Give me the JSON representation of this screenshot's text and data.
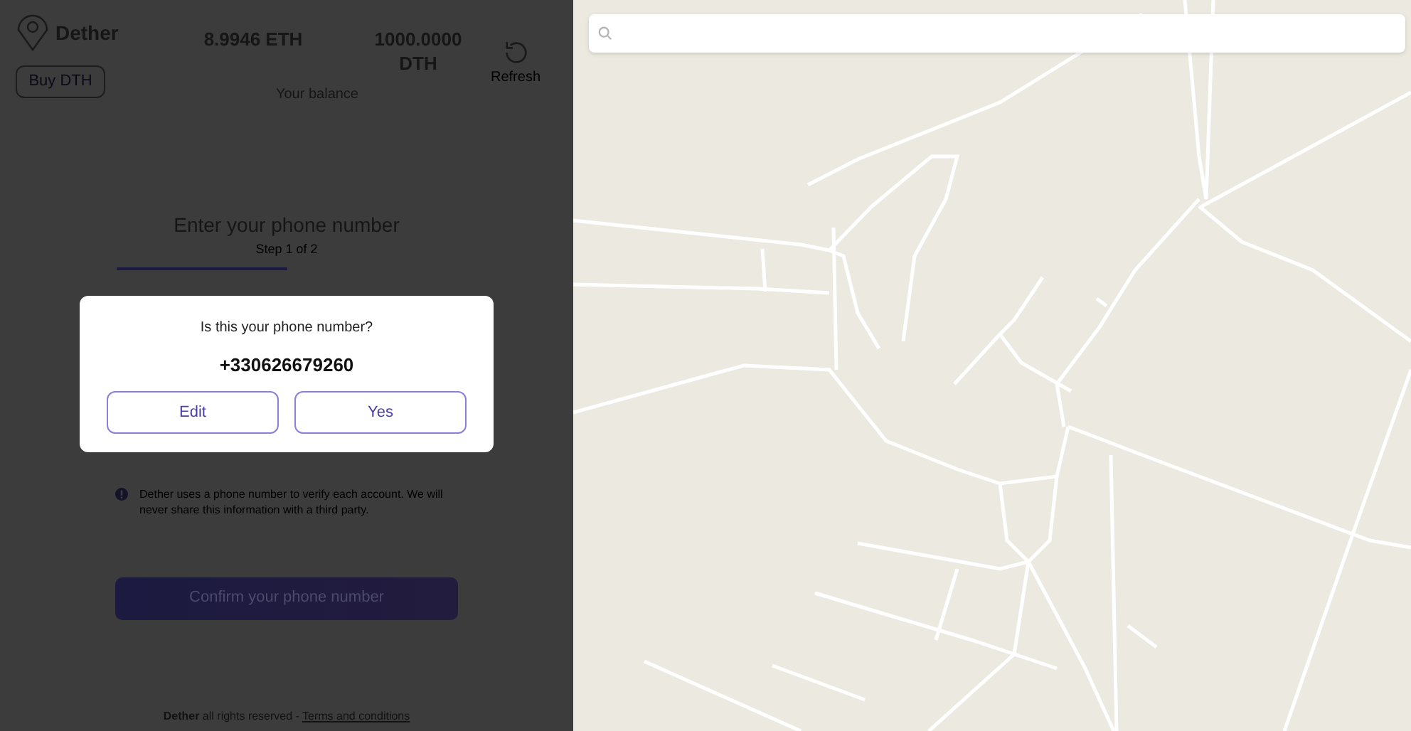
{
  "app": {
    "name": "Dether"
  },
  "header": {
    "buy_button": "Buy DTH",
    "balances": [
      "8.9946 ETH",
      "1000.0000 DTH"
    ],
    "balance_label": "Your balance",
    "refresh": "Refresh"
  },
  "form": {
    "title": "Enter your phone number",
    "step": "Step 1 of 2",
    "progress": {
      "level": 0.5
    },
    "notice": "Dether uses a phone number to verify each account. We will never share this information with a third party.",
    "confirm_button": "Confirm your phone number"
  },
  "dialog": {
    "question": "Is this your phone number?",
    "phone": "+330626679260",
    "buttons": [
      "Edit",
      "Yes"
    ]
  },
  "footer": {
    "text": "**Dether** all rights reserved -",
    "link": "Terms and conditions"
  }
}
